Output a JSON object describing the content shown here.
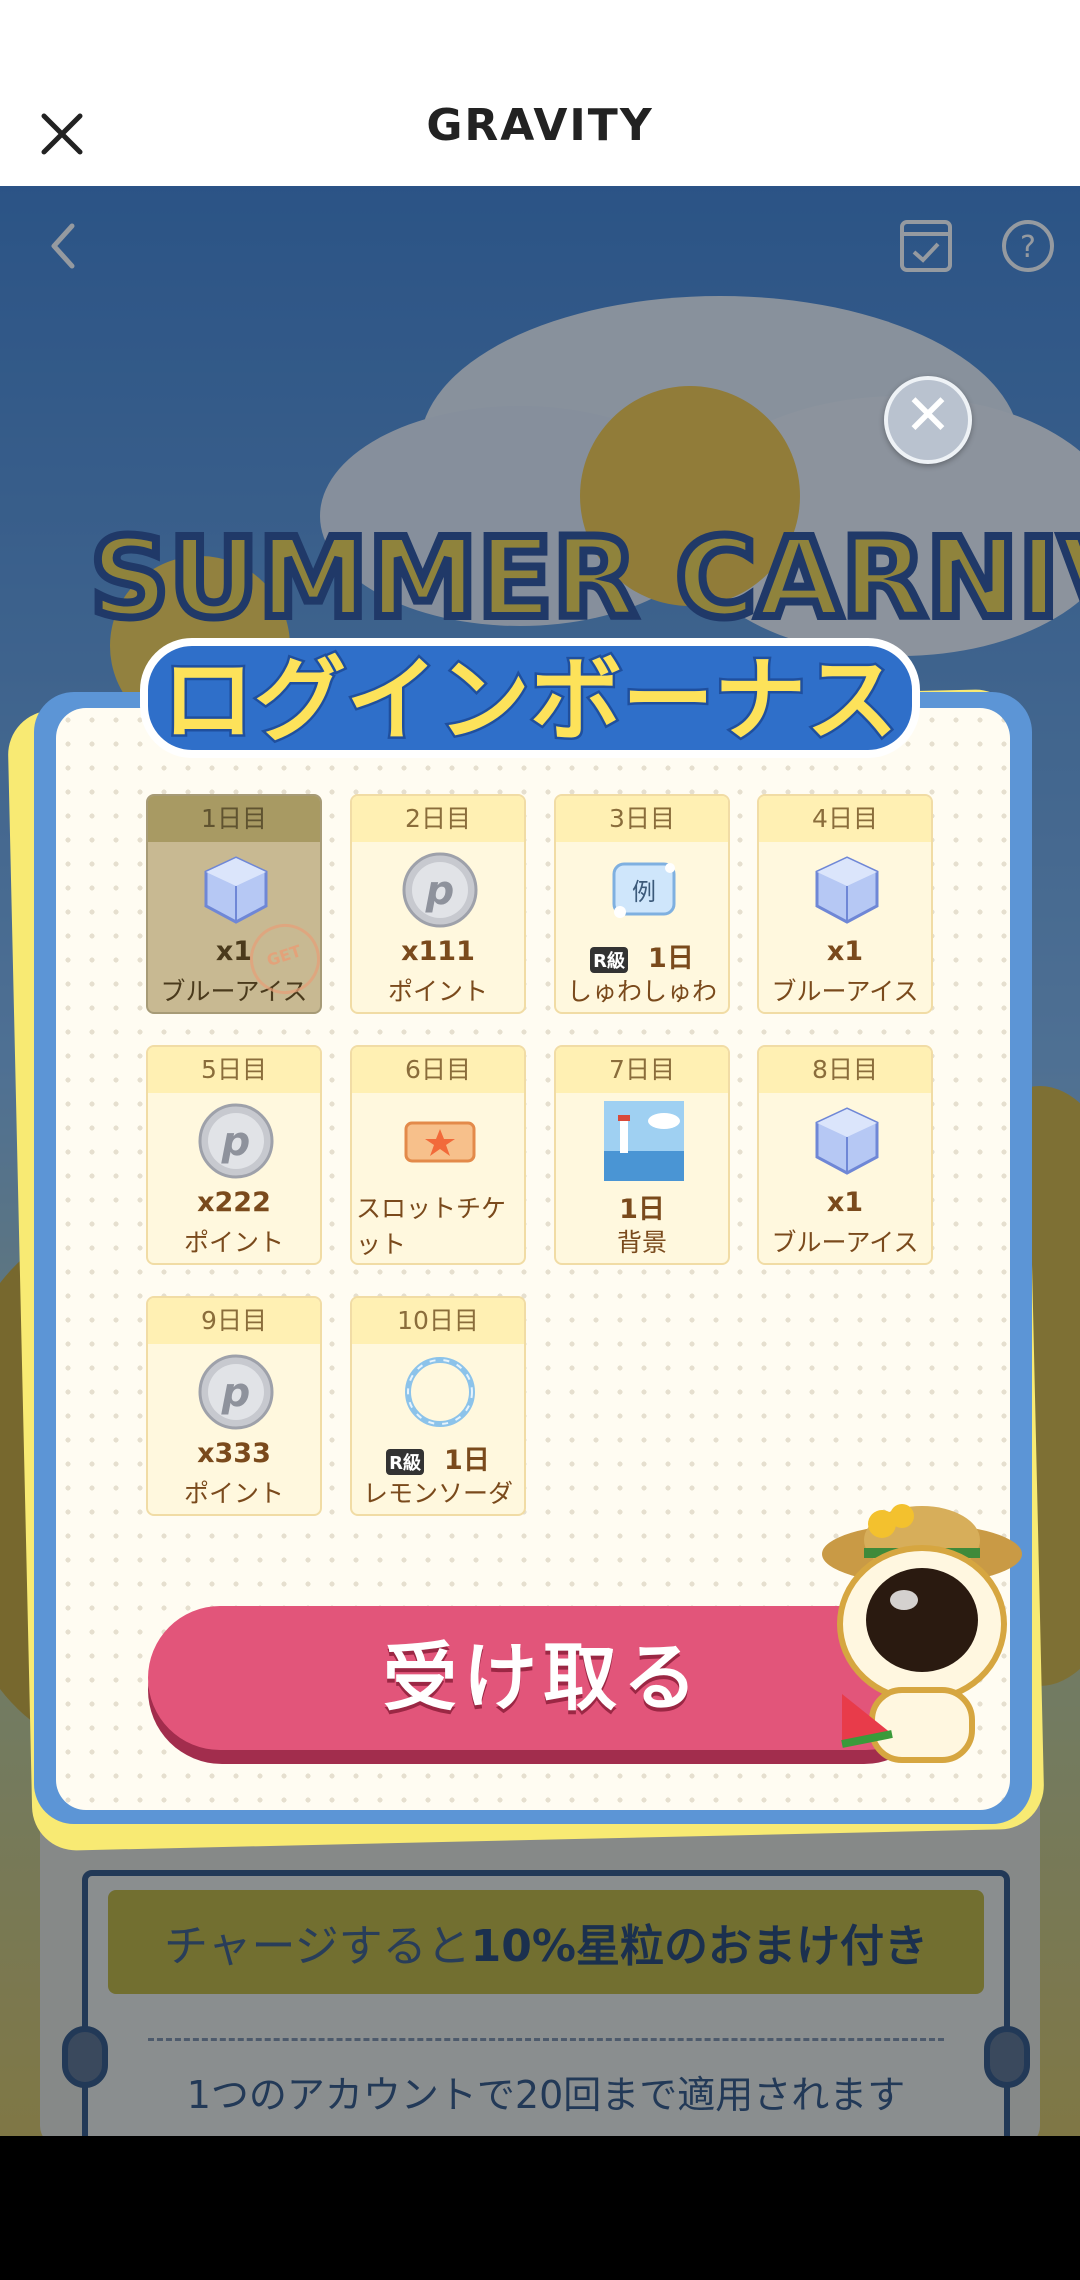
{
  "header": {
    "title": "GRAVITY",
    "close_icon": "close-icon"
  },
  "page": {
    "back_icon": "back-chevron-icon",
    "check_icon": "checklist-icon",
    "help_icon": "help-icon",
    "banner_text": "SUMMER CARNIVAL"
  },
  "charge": {
    "text_plain": "チャージすると",
    "text_bold": "10%星粒のおまけ付き",
    "note": "1つのアカウントで20回まで適用されます"
  },
  "modal": {
    "title": "ログインボーナス",
    "close_icon": "close-icon",
    "receive_button": "受け取る",
    "cards": [
      {
        "day": "1日目",
        "icon": "blue-ice-icon",
        "amount": "x1",
        "name": "ブルーアイス",
        "claimed": true,
        "stamp": "GET"
      },
      {
        "day": "2日目",
        "icon": "point-coin-icon",
        "amount": "x111",
        "name": "ポイント"
      },
      {
        "day": "3日目",
        "icon": "example-card-icon",
        "icon_text": "例",
        "badge": "R級",
        "amount": "1日",
        "name": "しゅわしゅわ"
      },
      {
        "day": "4日目",
        "icon": "blue-ice-icon",
        "amount": "x1",
        "name": "ブルーアイス"
      },
      {
        "day": "5日目",
        "icon": "point-coin-icon",
        "amount": "x222",
        "name": "ポイント"
      },
      {
        "day": "6日目",
        "icon": "slot-ticket-icon",
        "amount": "",
        "name": "スロットチケット"
      },
      {
        "day": "7日目",
        "icon": "lighthouse-background-icon",
        "amount": "1日",
        "name": "背景"
      },
      {
        "day": "8日目",
        "icon": "blue-ice-icon",
        "amount": "x1",
        "name": "ブルーアイス"
      },
      {
        "day": "9日目",
        "icon": "point-coin-icon",
        "amount": "x333",
        "name": "ポイント"
      },
      {
        "day": "10日目",
        "icon": "lemon-soda-frame-icon",
        "badge": "R級",
        "amount": "1日",
        "name": "レモンソーダ"
      }
    ]
  },
  "colors": {
    "accent_pink": "#e2557a",
    "modal_blue": "#5c95d6",
    "modal_yellow": "#f8ea73",
    "title_blue": "#2f6fc9"
  }
}
